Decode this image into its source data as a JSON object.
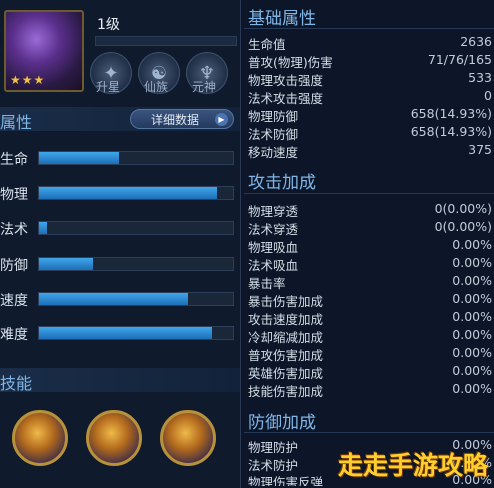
{
  "hero": {
    "level": "1级",
    "stars": "★★★"
  },
  "tags": [
    {
      "label": "升星",
      "icon": "star-upgrade-icon"
    },
    {
      "label": "仙族",
      "icon": "fairy-race-icon"
    },
    {
      "label": "元神",
      "icon": "spirit-icon"
    }
  ],
  "attributes": {
    "title": "属性",
    "detail_button": "详细数据",
    "items": [
      {
        "label": "生命",
        "fill": 0.41
      },
      {
        "label": "物理",
        "fill": 0.92
      },
      {
        "label": "法术",
        "fill": 0.04
      },
      {
        "label": "防御",
        "fill": 0.28
      },
      {
        "label": "速度",
        "fill": 0.77
      },
      {
        "label": "难度",
        "fill": 0.89
      }
    ]
  },
  "skills": {
    "title": "技能",
    "count": 3
  },
  "base": {
    "title": "基础属性",
    "rows": [
      {
        "k": "生命值",
        "v": "2636"
      },
      {
        "k": "普攻(物理)伤害",
        "v": "71/76/165"
      },
      {
        "k": "物理攻击强度",
        "v": "533"
      },
      {
        "k": "法术攻击强度",
        "v": "0"
      },
      {
        "k": "物理防御",
        "v": "658(14.93%)"
      },
      {
        "k": "法术防御",
        "v": "658(14.93%)"
      },
      {
        "k": "移动速度",
        "v": "375"
      }
    ]
  },
  "attack": {
    "title": "攻击加成",
    "rows": [
      {
        "k": "物理穿透",
        "v": "0(0.00%)"
      },
      {
        "k": "法术穿透",
        "v": "0(0.00%)"
      },
      {
        "k": "物理吸血",
        "v": "0.00%"
      },
      {
        "k": "法术吸血",
        "v": "0.00%"
      },
      {
        "k": "暴击率",
        "v": "0.00%"
      },
      {
        "k": "暴击伤害加成",
        "v": "0.00%"
      },
      {
        "k": "攻击速度加成",
        "v": "0.00%"
      },
      {
        "k": "冷却缩减加成",
        "v": "0.00%"
      },
      {
        "k": "普攻伤害加成",
        "v": "0.00%"
      },
      {
        "k": "英雄伤害加成",
        "v": "0.00%"
      },
      {
        "k": "技能伤害加成",
        "v": "0.00%"
      }
    ]
  },
  "defense": {
    "title": "防御加成",
    "rows": [
      {
        "k": "物理防护",
        "v": "0.00%"
      },
      {
        "k": "法术防护",
        "v": "0.00%"
      },
      {
        "k": "物理伤害反弹",
        "v": "0.00%"
      }
    ]
  },
  "watermark": "走走手游攻略"
}
